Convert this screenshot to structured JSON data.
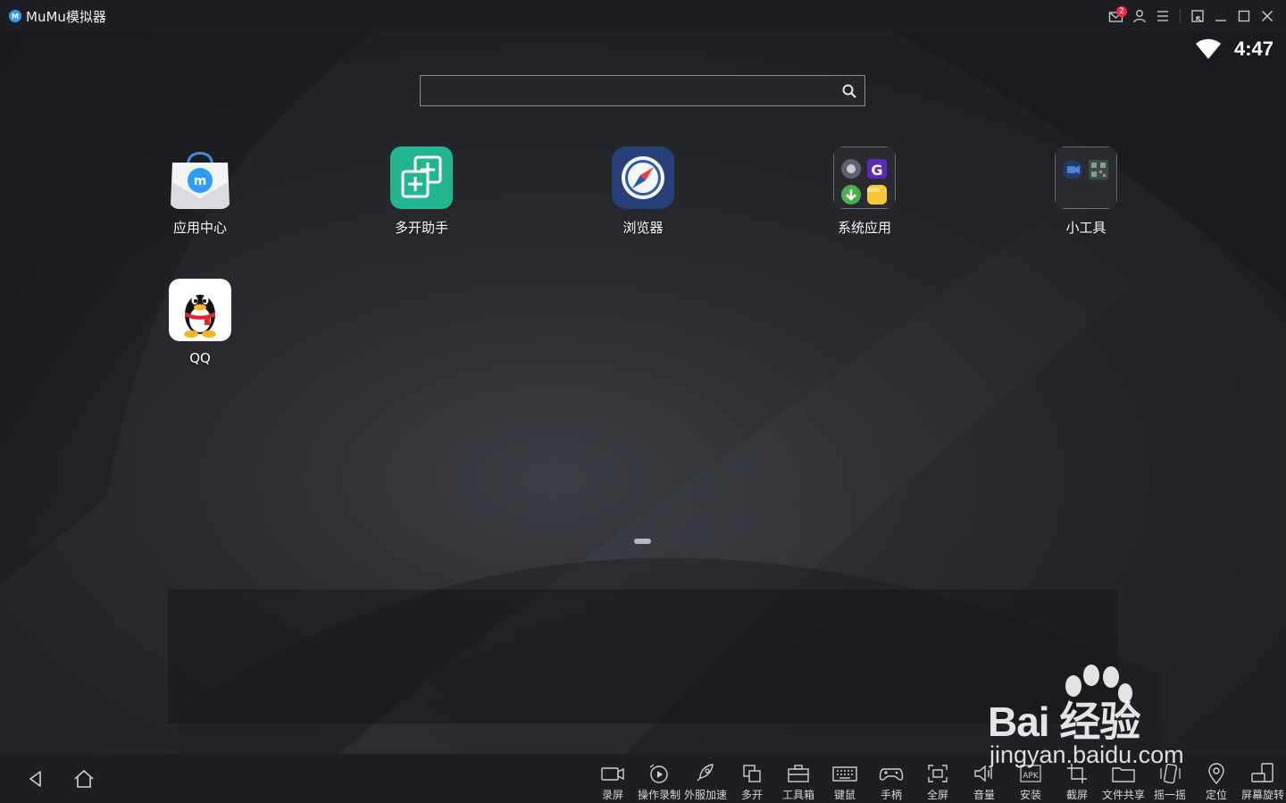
{
  "window": {
    "title": "MuMu模拟器",
    "logo_letter": "M",
    "notification_count": "2"
  },
  "status": {
    "time": "4:47"
  },
  "search": {
    "placeholder": ""
  },
  "apps": [
    {
      "label": "应用中心",
      "icon": "app-center-bag-icon"
    },
    {
      "label": "多开助手",
      "icon": "multi-instance-icon"
    },
    {
      "label": "浏览器",
      "icon": "compass-browser-icon"
    },
    {
      "label": "系统应用",
      "icon": "system-apps-folder-icon"
    },
    {
      "label": "小工具",
      "icon": "tools-folder-icon"
    },
    {
      "label": "QQ",
      "icon": "qq-penguin-icon"
    }
  ],
  "toolbar": [
    {
      "label": "录屏",
      "icon": "video-camera-icon"
    },
    {
      "label": "操作录制",
      "icon": "macro-record-icon"
    },
    {
      "label": "外服加速",
      "icon": "rocket-icon"
    },
    {
      "label": "多开",
      "icon": "multi-window-icon"
    },
    {
      "label": "工具箱",
      "icon": "toolbox-icon"
    },
    {
      "label": "键鼠",
      "icon": "keyboard-icon"
    },
    {
      "label": "手柄",
      "icon": "gamepad-icon"
    },
    {
      "label": "全屏",
      "icon": "fullscreen-icon"
    },
    {
      "label": "音量",
      "icon": "volume-icon"
    },
    {
      "label": "安装",
      "icon": "apk-install-icon"
    },
    {
      "label": "截屏",
      "icon": "crop-screenshot-icon"
    },
    {
      "label": "文件共享",
      "icon": "folder-share-icon"
    },
    {
      "label": "摇一摇",
      "icon": "shake-icon"
    },
    {
      "label": "定位",
      "icon": "location-pin-icon"
    },
    {
      "label": "屏幕旋转",
      "icon": "rotate-screen-icon"
    }
  ],
  "watermark": {
    "brand": "Bai  经验",
    "url": "jingyan.baidu.com"
  },
  "colors": {
    "titlebar": "#1d1e21",
    "accent_blue": "#2f9bf5",
    "badge_red": "#f2294a",
    "multi_green": "#22b58f",
    "browser_navy": "#27407a"
  }
}
